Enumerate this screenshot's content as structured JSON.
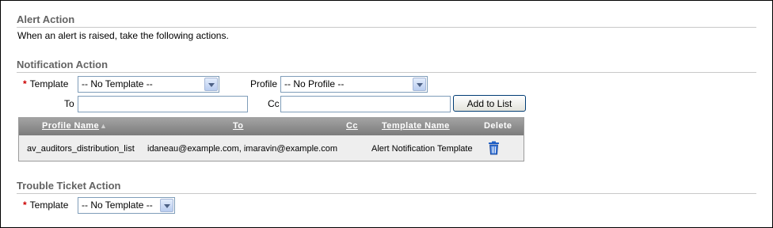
{
  "alert_action": {
    "title": "Alert Action",
    "description": "When an alert is raised, take the following actions."
  },
  "notification_action": {
    "title": "Notification Action",
    "template_label": "Template",
    "template_value": "-- No Template --",
    "profile_label": "Profile",
    "profile_value": "-- No Profile --",
    "to_label": "To",
    "to_value": "",
    "cc_label": "Cc",
    "cc_value": "",
    "add_button": "Add to List",
    "table": {
      "columns": [
        "Profile Name",
        "To",
        "Cc",
        "Template Name",
        "Delete"
      ],
      "sort_indicator": "▲",
      "rows": [
        {
          "profile_name": "av_auditors_distribution_list",
          "to": "idaneau@example.com, imaravin@example.com",
          "cc": "",
          "template_name": "Alert Notification Template",
          "delete_icon": "trash-icon"
        }
      ]
    }
  },
  "trouble_ticket_action": {
    "title": "Trouble Ticket Action",
    "template_label": "Template",
    "template_value": "-- No Template --"
  },
  "required_marker": "*",
  "colors": {
    "section_title": "#636363",
    "required": "#cc0000",
    "table_header": "#8c8c8c",
    "table_body": "#eeeeee",
    "trash_icon": "#1f5fc6"
  }
}
